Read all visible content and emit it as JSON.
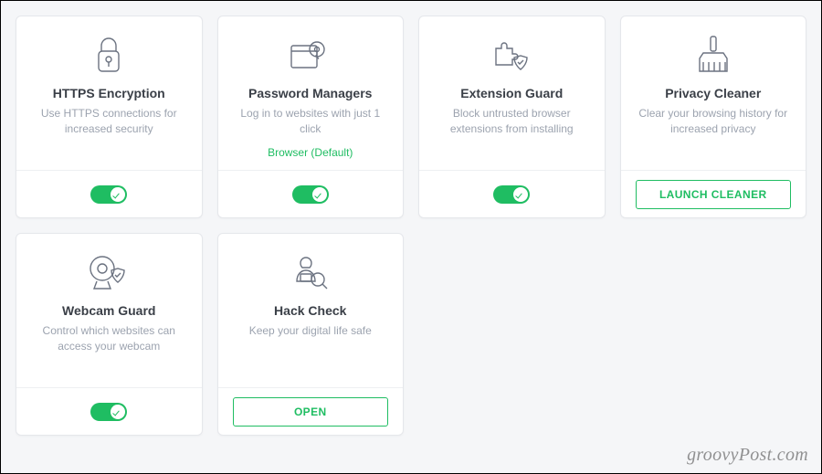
{
  "colors": {
    "accent": "#1fbd62",
    "muted": "#9ca3af",
    "title": "#3a3f47"
  },
  "cards": [
    {
      "icon": "lock",
      "title": "HTTPS Encryption",
      "desc": "Use HTTPS connections for increased security",
      "extra": null,
      "footer": {
        "type": "toggle",
        "on": true
      }
    },
    {
      "icon": "password",
      "title": "Password Managers",
      "desc": "Log in to websites with just 1 click",
      "extra": "Browser (Default)",
      "footer": {
        "type": "toggle",
        "on": true
      }
    },
    {
      "icon": "extension",
      "title": "Extension Guard",
      "desc": "Block untrusted browser extensions from installing",
      "extra": null,
      "footer": {
        "type": "toggle",
        "on": true
      }
    },
    {
      "icon": "cleaner",
      "title": "Privacy Cleaner",
      "desc": "Clear your browsing history for increased privacy",
      "extra": null,
      "footer": {
        "type": "button",
        "label": "LAUNCH CLEANER"
      }
    },
    {
      "icon": "webcam",
      "title": "Webcam Guard",
      "desc": "Control which websites can access your webcam",
      "extra": null,
      "footer": {
        "type": "toggle",
        "on": true
      }
    },
    {
      "icon": "hack",
      "title": "Hack Check",
      "desc": "Keep your digital life safe",
      "extra": null,
      "footer": {
        "type": "button",
        "label": "OPEN"
      }
    }
  ],
  "watermark": "groovyPost.com"
}
